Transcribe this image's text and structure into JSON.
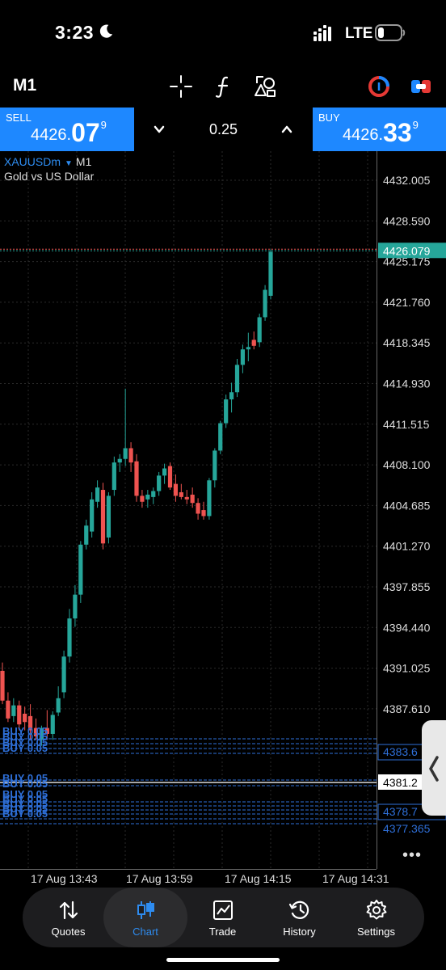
{
  "status_bar": {
    "time": "3:23",
    "network": "LTE"
  },
  "toolbar": {
    "timeframe": "M1",
    "icons": [
      "crosshair-icon",
      "indicator-f-icon",
      "drawing-objects-icon",
      "chart-style-icon",
      "trade-mode-icon"
    ]
  },
  "trade_panel": {
    "sell": {
      "label": "SELL",
      "price_small": "4426.",
      "price_big": "07",
      "price_sup": "9"
    },
    "buy": {
      "label": "BUY",
      "price_small": "4426.",
      "price_big": "33",
      "price_sup": "9"
    },
    "lot": "0.25"
  },
  "chart": {
    "symbol": "XAUUSDm",
    "timeframe": "M1",
    "description": "Gold vs US Dollar",
    "current_price_label": "4426.079",
    "colors": {
      "up": "#26a69a",
      "down": "#ef5350",
      "order_lines": "#2e6fd8",
      "current_price_bg": "#26a69a",
      "bid_line": "#ef5350"
    },
    "order_price_labels": [
      "4383.6",
      "4381.2",
      "4378.7"
    ],
    "overflow_price_label": "4377.365",
    "order_text": [
      "BUY 0.05",
      "BUY 0.05"
    ]
  },
  "chart_data": {
    "type": "candlestick",
    "price_axis": [
      "4432.005",
      "4428.590",
      "4425.175",
      "4421.760",
      "4418.345",
      "4414.930",
      "4411.515",
      "4408.100",
      "4404.685",
      "4401.270",
      "4397.855",
      "4394.440",
      "4391.025",
      "4387.610"
    ],
    "time_axis": [
      "17 Aug 13:43",
      "17 Aug 13:59",
      "17 Aug 14:15",
      "17 Aug 14:31"
    ],
    "ylim": [
      4376.5,
      4433.2
    ],
    "current_price": 4426.079,
    "order_levels": [
      4383.6,
      4381.2,
      4378.7
    ],
    "candles": [
      {
        "o": 4390.8,
        "h": 4391.5,
        "l": 4388.0,
        "c": 4388.3
      },
      {
        "o": 4388.3,
        "h": 4389.0,
        "l": 4386.5,
        "c": 4386.8
      },
      {
        "o": 4387.0,
        "h": 4388.5,
        "l": 4386.5,
        "c": 4387.9
      },
      {
        "o": 4387.9,
        "h": 4388.3,
        "l": 4385.8,
        "c": 4386.3
      },
      {
        "o": 4387.2,
        "h": 4387.8,
        "l": 4385.8,
        "c": 4386.5
      },
      {
        "o": 4387.0,
        "h": 4388.0,
        "l": 4385.0,
        "c": 4385.8
      },
      {
        "o": 4386.0,
        "h": 4386.8,
        "l": 4385.0,
        "c": 4385.3
      },
      {
        "o": 4385.0,
        "h": 4386.2,
        "l": 4384.5,
        "c": 4386.0
      },
      {
        "o": 4386.0,
        "h": 4387.5,
        "l": 4385.0,
        "c": 4385.5
      },
      {
        "o": 4385.5,
        "h": 4387.4,
        "l": 4385.0,
        "c": 4387.1
      },
      {
        "o": 4387.3,
        "h": 4389.5,
        "l": 4387.0,
        "c": 4388.5
      },
      {
        "o": 4389.0,
        "h": 4392.5,
        "l": 4388.5,
        "c": 4392.0
      },
      {
        "o": 4392.0,
        "h": 4396.0,
        "l": 4391.5,
        "c": 4395.2
      },
      {
        "o": 4395.2,
        "h": 4398.0,
        "l": 4394.5,
        "c": 4397.2
      },
      {
        "o": 4397.2,
        "h": 4401.7,
        "l": 4396.5,
        "c": 4401.4
      },
      {
        "o": 4401.4,
        "h": 4403.5,
        "l": 4401.0,
        "c": 4403.0
      },
      {
        "o": 4402.5,
        "h": 4405.8,
        "l": 4402.0,
        "c": 4405.2
      },
      {
        "o": 4405.0,
        "h": 4406.8,
        "l": 4404.5,
        "c": 4406.2
      },
      {
        "o": 4406.0,
        "h": 4406.6,
        "l": 4401.0,
        "c": 4401.5
      },
      {
        "o": 4402.0,
        "h": 4405.8,
        "l": 4401.5,
        "c": 4405.5
      },
      {
        "o": 4406.0,
        "h": 4408.8,
        "l": 4405.5,
        "c": 4408.3
      },
      {
        "o": 4408.3,
        "h": 4409.0,
        "l": 4407.5,
        "c": 4408.6
      },
      {
        "o": 4408.6,
        "h": 4414.5,
        "l": 4408.0,
        "c": 4409.5
      },
      {
        "o": 4409.5,
        "h": 4410.0,
        "l": 4407.5,
        "c": 4408.3
      },
      {
        "o": 4408.4,
        "h": 4409.0,
        "l": 4405.0,
        "c": 4405.5
      },
      {
        "o": 4405.5,
        "h": 4406.0,
        "l": 4404.5,
        "c": 4405.0
      },
      {
        "o": 4405.2,
        "h": 4406.0,
        "l": 4404.5,
        "c": 4405.6
      },
      {
        "o": 4405.4,
        "h": 4406.2,
        "l": 4404.8,
        "c": 4405.9
      },
      {
        "o": 4405.9,
        "h": 4407.5,
        "l": 4405.5,
        "c": 4407.2
      },
      {
        "o": 4407.2,
        "h": 4408.2,
        "l": 4406.5,
        "c": 4407.8
      },
      {
        "o": 4408.0,
        "h": 4408.3,
        "l": 4406.0,
        "c": 4406.2
      },
      {
        "o": 4406.5,
        "h": 4407.3,
        "l": 4405.0,
        "c": 4405.5
      },
      {
        "o": 4405.8,
        "h": 4406.5,
        "l": 4405.2,
        "c": 4405.4
      },
      {
        "o": 4405.4,
        "h": 4406.0,
        "l": 4404.8,
        "c": 4405.2
      },
      {
        "o": 4405.6,
        "h": 4406.2,
        "l": 4404.5,
        "c": 4404.9
      },
      {
        "o": 4404.9,
        "h": 4405.3,
        "l": 4403.5,
        "c": 4404.0
      },
      {
        "o": 4404.3,
        "h": 4405.0,
        "l": 4403.5,
        "c": 4403.8
      },
      {
        "o": 4403.8,
        "h": 4407.0,
        "l": 4403.5,
        "c": 4406.8
      },
      {
        "o": 4406.8,
        "h": 4409.5,
        "l": 4406.2,
        "c": 4409.3
      },
      {
        "o": 4409.3,
        "h": 4411.8,
        "l": 4409.0,
        "c": 4411.6
      },
      {
        "o": 4411.6,
        "h": 4414.0,
        "l": 4411.2,
        "c": 4413.6
      },
      {
        "o": 4413.6,
        "h": 4415.0,
        "l": 4412.5,
        "c": 4414.2
      },
      {
        "o": 4414.2,
        "h": 4417.0,
        "l": 4413.8,
        "c": 4416.5
      },
      {
        "o": 4416.5,
        "h": 4418.2,
        "l": 4415.8,
        "c": 4417.8
      },
      {
        "o": 4417.8,
        "h": 4419.2,
        "l": 4416.8,
        "c": 4418.0
      },
      {
        "o": 4418.6,
        "h": 4419.3,
        "l": 4417.8,
        "c": 4418.1
      },
      {
        "o": 4418.4,
        "h": 4420.8,
        "l": 4418.0,
        "c": 4420.5
      },
      {
        "o": 4420.5,
        "h": 4423.2,
        "l": 4420.2,
        "c": 4422.8
      },
      {
        "o": 4422.3,
        "h": 4426.2,
        "l": 4422.0,
        "c": 4426.0
      }
    ]
  },
  "nav": {
    "items": [
      {
        "label": "Quotes"
      },
      {
        "label": "Chart"
      },
      {
        "label": "Trade"
      },
      {
        "label": "History"
      },
      {
        "label": "Settings"
      }
    ]
  }
}
